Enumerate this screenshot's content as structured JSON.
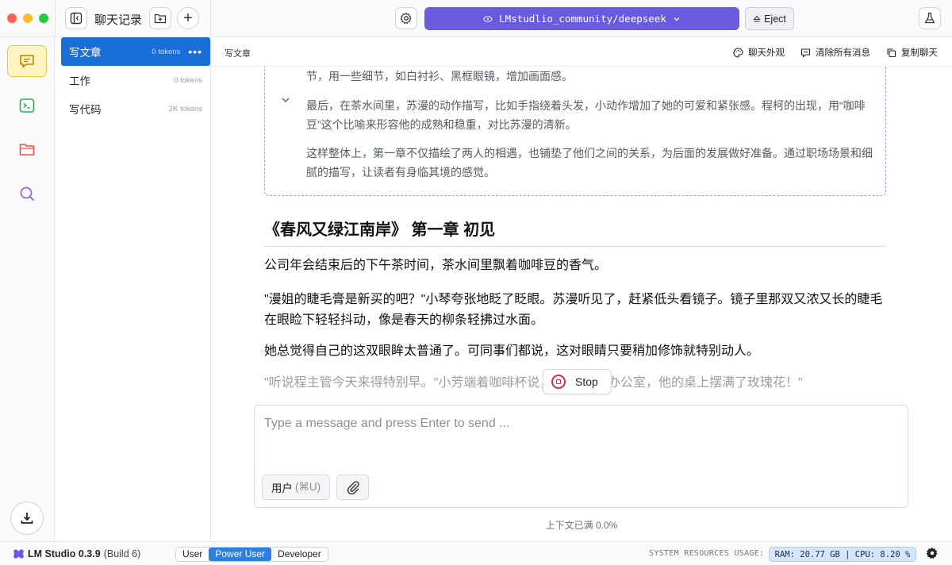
{
  "window": {
    "sidebar_title": "聊天记录",
    "model_name": "LMstudlio_community/deepseek",
    "eject_label": "Eject"
  },
  "conversations": [
    {
      "name": "写文章",
      "tokens": "0 tokens",
      "active": true
    },
    {
      "name": "工作",
      "tokens": "0 tokens",
      "active": false
    },
    {
      "name": "写代码",
      "tokens": "2K tokens",
      "active": false
    }
  ],
  "chat_header": {
    "name": "写文章",
    "actions": {
      "appearance": "聊天外观",
      "clear": "清除所有消息",
      "copy": "复制聊天"
    }
  },
  "thinking": {
    "partial_line": "节，用一些细节，如白衬衫、黑框眼镜，增加画面感。",
    "para1": "最后，在茶水间里，苏漫的动作描写，比如手指绕着头发，小动作增加了她的可爱和紧张感。程柯的出现，用“咖啡豆”这个比喻来形容他的成熟和稳重，对比苏漫的清新。",
    "para2": "这样整体上，第一章不仅描绘了两人的相遇，也铺垫了他们之间的关系，为后面的发展做好准备。通过职场场景和细腻的描写，让读者有身临其境的感觉。"
  },
  "response": {
    "heading": "《春风又绿江南岸》 第一章 初见",
    "p1": "公司年会结束后的下午茶时间，茶水间里飘着咖啡豆的香气。",
    "p2": "\"漫姐的睫毛膏是新买的吧？\"小琴夸张地眨了眨眼。苏漫听见了，赶紧低头看镜子。镜子里那双又浓又长的睫毛在眼睑下轻轻抖动，像是春天的柳条轻拂过水面。",
    "p3": "她总觉得自己的这双眼眸太普通了。可同事们都说，这对眼睛只要稍加修饰就特别动人。",
    "p4": "\"听说程主管今天来得特别早。\"小芳端着咖啡杯说，\"刚才去他办公室，他的桌上摆满了玫瑰花！\""
  },
  "stop_label": "Stop",
  "composer": {
    "placeholder": "Type a message and press Enter to send ...",
    "role_label": "用户",
    "role_shortcut": "(⌘U)"
  },
  "context_status": "上下文已满 0.0%",
  "statusbar": {
    "app_name": "LM Studio 0.3.9",
    "build": "(Build 6)",
    "modes": [
      "User",
      "Power User",
      "Developer"
    ],
    "active_mode": "Power User",
    "resources_label": "SYSTEM RESOURCES USAGE:",
    "resources_value": "RAM: 20.77 GB | CPU: 8.20 %"
  },
  "colors": {
    "accent_purple": "#6a5ae0",
    "active_blue": "#1a6ed8",
    "stop_red": "#e02b3d",
    "rail_active": "#fff4c2"
  },
  "icons": [
    "sidebar-toggle-icon",
    "new-folder-icon",
    "plus-icon",
    "gear-icon",
    "eject-icon",
    "flask-icon",
    "chat-icon",
    "terminal-icon",
    "folder-icon",
    "search-icon",
    "download-icon",
    "palette-icon",
    "clear-messages-icon",
    "copy-icon",
    "chevron-down-icon",
    "stop-icon",
    "paperclip-icon",
    "lm-logo-icon"
  ]
}
